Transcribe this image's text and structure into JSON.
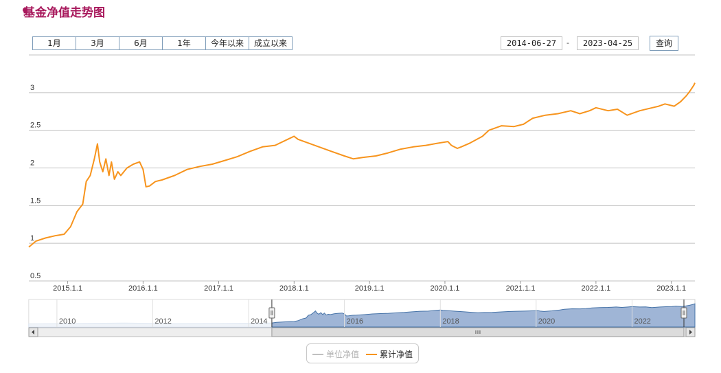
{
  "header": {
    "title": "基金净值走势图"
  },
  "controls": {
    "range_buttons": [
      "1月",
      "3月",
      "6月",
      "1年",
      "今年以来",
      "成立以来"
    ],
    "start_date": "2014-06-27",
    "end_date": "2023-04-25",
    "separator": "-",
    "query_label": "查询"
  },
  "colors": {
    "accent": "#a8185c",
    "series_line": "#f7941d",
    "inactive_series": "#c0c0c0",
    "grid": "#c0c0c0",
    "navigator_fill": "#9fb5d6",
    "navigator_line": "#4572a7"
  },
  "chart_data": {
    "type": "line",
    "y_ticks": [
      "0.5",
      "1",
      "1.5",
      "2",
      "2.5",
      "3"
    ],
    "ylim": [
      0.5,
      3.5
    ],
    "x_ticks": [
      "2015.1.1",
      "2016.1.1",
      "2017.1.1",
      "2018.1.1",
      "2019.1.1",
      "2020.1.1",
      "2021.1.1",
      "2022.1.1",
      "2023.1.1"
    ],
    "grid": true,
    "legend_position": "bottom-center",
    "series": [
      {
        "name": "单位净值",
        "visible": false,
        "color": "#c0c0c0",
        "x": [],
        "y": []
      },
      {
        "name": "累计净值",
        "visible": true,
        "color": "#f7941d",
        "x": [
          "2014-06-27",
          "2014-08-01",
          "2014-09-15",
          "2014-11-01",
          "2014-12-15",
          "2015-01-15",
          "2015-02-15",
          "2015-03-15",
          "2015-04-01",
          "2015-04-20",
          "2015-05-10",
          "2015-05-25",
          "2015-06-05",
          "2015-06-20",
          "2015-07-05",
          "2015-07-20",
          "2015-08-01",
          "2015-08-15",
          "2015-09-01",
          "2015-09-15",
          "2015-10-15",
          "2015-11-15",
          "2015-12-15",
          "2016-01-01",
          "2016-01-15",
          "2016-02-01",
          "2016-03-01",
          "2016-04-01",
          "2016-06-01",
          "2016-08-01",
          "2016-10-01",
          "2016-12-01",
          "2017-02-01",
          "2017-04-01",
          "2017-06-01",
          "2017-08-01",
          "2017-10-01",
          "2017-12-01",
          "2018-01-01",
          "2018-01-20",
          "2018-03-01",
          "2018-05-01",
          "2018-07-01",
          "2018-09-01",
          "2018-10-15",
          "2018-12-01",
          "2019-02-01",
          "2019-04-01",
          "2019-06-01",
          "2019-08-01",
          "2019-10-01",
          "2019-12-01",
          "2020-01-15",
          "2020-02-01",
          "2020-03-01",
          "2020-03-20",
          "2020-05-01",
          "2020-07-01",
          "2020-08-01",
          "2020-10-01",
          "2020-12-01",
          "2021-01-15",
          "2021-03-01",
          "2021-05-01",
          "2021-07-01",
          "2021-09-01",
          "2021-10-15",
          "2021-12-01",
          "2022-01-01",
          "2022-03-01",
          "2022-04-15",
          "2022-06-01",
          "2022-08-01",
          "2022-10-01",
          "2022-11-01",
          "2022-12-01",
          "2023-01-15",
          "2023-02-15",
          "2023-03-15",
          "2023-04-01",
          "2023-04-20",
          "2023-04-25"
        ],
        "y": [
          0.95,
          1.03,
          1.07,
          1.1,
          1.12,
          1.22,
          1.42,
          1.52,
          1.82,
          1.9,
          2.12,
          2.32,
          2.08,
          1.95,
          2.12,
          1.9,
          2.08,
          1.85,
          1.95,
          1.9,
          2.0,
          2.05,
          2.08,
          1.98,
          1.75,
          1.76,
          1.82,
          1.84,
          1.9,
          1.98,
          2.02,
          2.05,
          2.1,
          2.15,
          2.22,
          2.28,
          2.3,
          2.38,
          2.42,
          2.38,
          2.34,
          2.28,
          2.22,
          2.16,
          2.12,
          2.14,
          2.16,
          2.2,
          2.25,
          2.28,
          2.3,
          2.33,
          2.35,
          2.3,
          2.26,
          2.28,
          2.33,
          2.42,
          2.5,
          2.56,
          2.55,
          2.58,
          2.66,
          2.7,
          2.72,
          2.76,
          2.72,
          2.76,
          2.8,
          2.76,
          2.78,
          2.7,
          2.76,
          2.8,
          2.82,
          2.85,
          2.82,
          2.88,
          2.96,
          3.02,
          3.1,
          3.13
        ]
      }
    ],
    "navigator": {
      "x_ticks": [
        "2010",
        "2012",
        "2014",
        "2016",
        "2018",
        "2020",
        "2022"
      ],
      "selected_range": [
        "2014-06-27",
        "2023-04-25"
      ]
    }
  }
}
